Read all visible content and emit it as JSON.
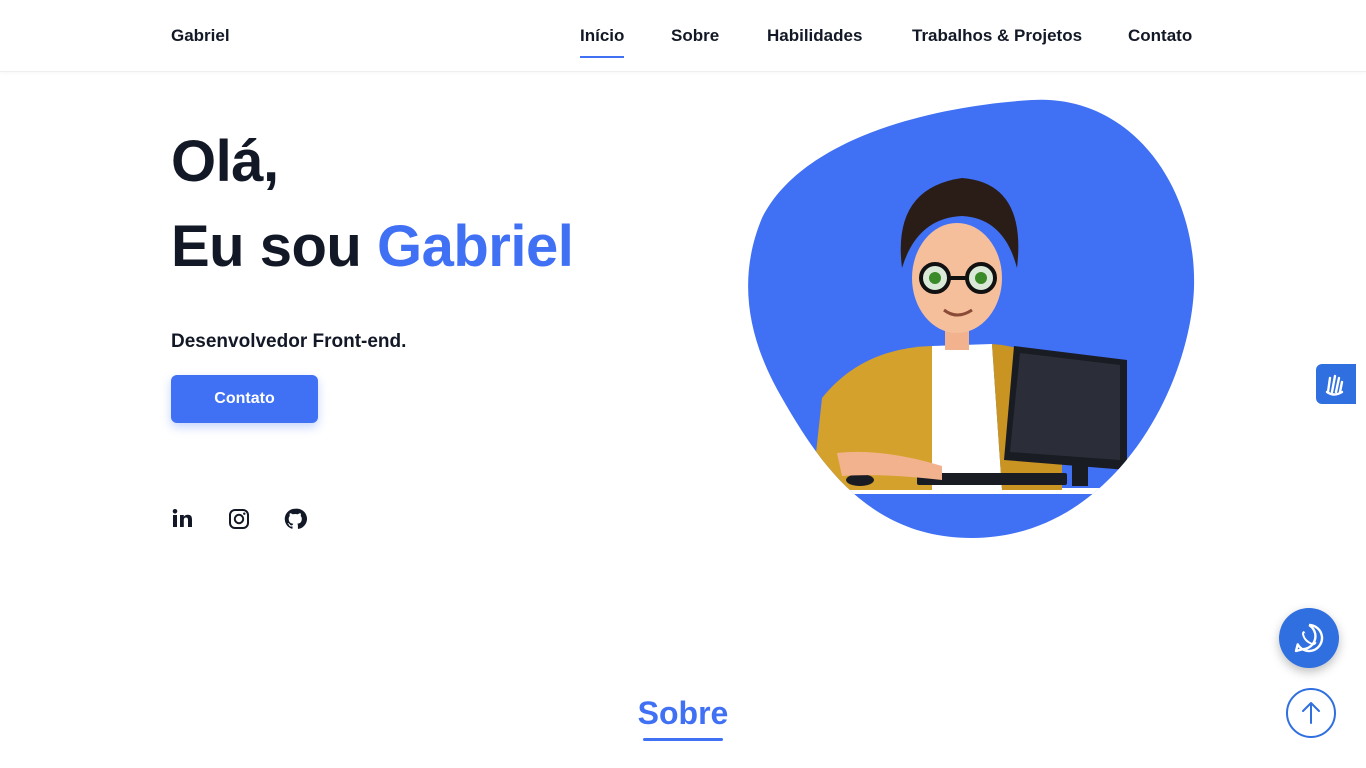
{
  "header": {
    "logo": "Gabriel",
    "nav": [
      {
        "label": "Início",
        "active": true
      },
      {
        "label": "Sobre",
        "active": false
      },
      {
        "label": "Habilidades",
        "active": false
      },
      {
        "label": "Trabalhos & Projetos",
        "active": false
      },
      {
        "label": "Contato",
        "active": false
      }
    ]
  },
  "hero": {
    "greeting": "Olá,",
    "intro_prefix": "Eu sou ",
    "name": "Gabriel",
    "role": "Desenvolvedor Front-end.",
    "cta_label": "Contato",
    "social": [
      "linkedin-icon",
      "instagram-icon",
      "github-icon"
    ]
  },
  "floating": {
    "accessibility_icon": "sign-language-hands-icon",
    "whatsapp_icon": "whatsapp-icon",
    "back_to_top_icon": "arrow-up-icon"
  },
  "about": {
    "title": "Sobre"
  },
  "colors": {
    "accent": "#4070f4",
    "text": "#121826",
    "fab": "#2f6fe0"
  }
}
